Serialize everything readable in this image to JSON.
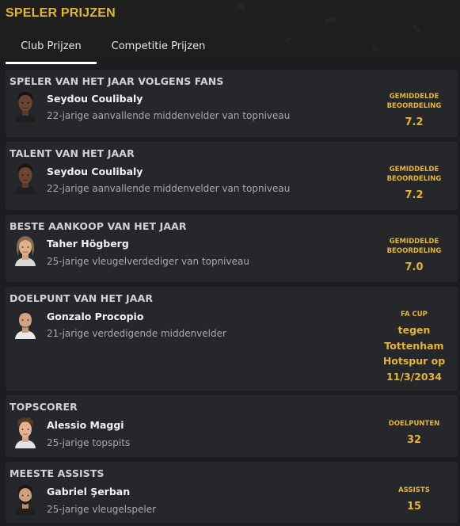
{
  "page": {
    "title": "SPELER PRIJZEN"
  },
  "tabs": [
    {
      "label": "Club Prijzen",
      "active": true
    },
    {
      "label": "Competitie Prijzen",
      "active": false
    }
  ],
  "awards": [
    {
      "title": "SPELER VAN HET JAAR VOLGENS FANS",
      "player": "Seydou Coulibaly",
      "description": "22-jarige aanvallende middenvelder van topniveau",
      "stat_label_lines": [
        "GEMIDDELDE",
        "BEOORDELING"
      ],
      "stat_value": "7.2",
      "avatar": "player-face-dark"
    },
    {
      "title": "TALENT VAN HET JAAR",
      "player": "Seydou Coulibaly",
      "description": "22-jarige aanvallende middenvelder van topniveau",
      "stat_label_lines": [
        "GEMIDDELDE",
        "BEOORDELING"
      ],
      "stat_value": "7.2",
      "avatar": "player-face-dark"
    },
    {
      "title": "BESTE AANKOOP VAN HET JAAR",
      "player": "Taher Högberg",
      "description": "25-jarige vleugelverdediger van topniveau",
      "stat_label_lines": [
        "GEMIDDELDE",
        "BEOORDELING"
      ],
      "stat_value": "7.0",
      "avatar": "player-face-longhair"
    },
    {
      "title": "DOELPUNT VAN HET JAAR",
      "player": "Gonzalo Procopio",
      "description": "21-jarige verdedigende middenvelder",
      "stat_label_lines": [
        "FA CUP"
      ],
      "stat_value_lines": [
        "tegen",
        "Tottenham",
        "Hotspur op",
        "11/3/2034"
      ],
      "avatar": "player-face-short"
    },
    {
      "title": "TOPSCORER",
      "player": "Alessio Maggi",
      "description": "25-jarige topspits",
      "stat_label_lines": [
        "DOELPUNTEN"
      ],
      "stat_value": "32",
      "avatar": "player-face-curly"
    },
    {
      "title": "MEESTE ASSISTS",
      "player": "Gabriel Şerban",
      "description": "25-jarige vleugelspeler",
      "stat_label_lines": [
        "ASSISTS"
      ],
      "stat_value": "15",
      "avatar": "player-face-beard"
    }
  ],
  "colors": {
    "accent": "#e4b432",
    "background": "#1b1d20",
    "card": "#25272b"
  }
}
